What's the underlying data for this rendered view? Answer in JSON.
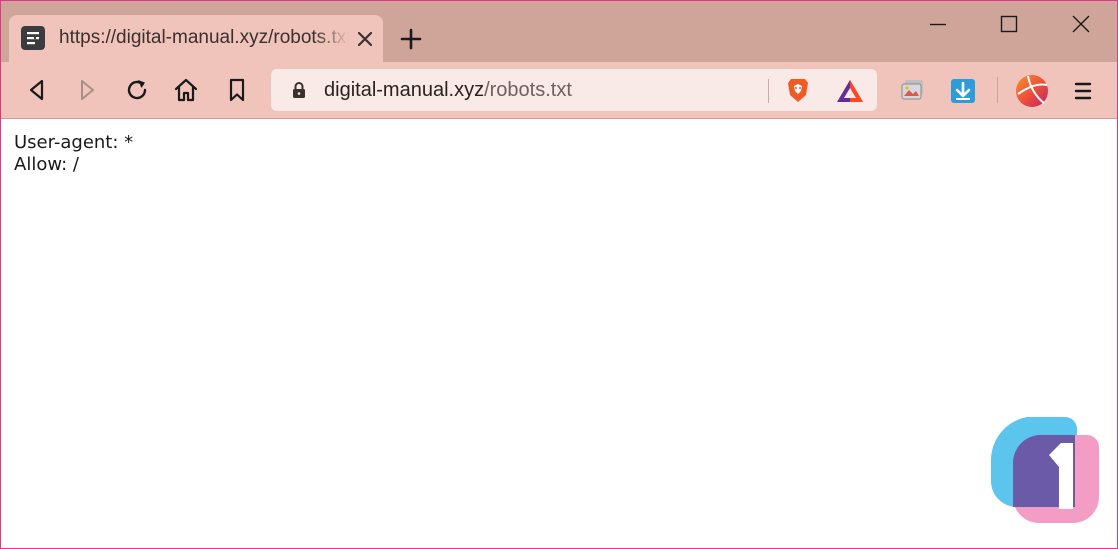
{
  "tab": {
    "title": "https://digital-manual.xyz/robots.txt",
    "favicon": "document-lines-icon"
  },
  "window_controls": {
    "minimize": "minimize-icon",
    "maximize": "maximize-icon",
    "close": "close-icon"
  },
  "navigation": {
    "back": "back-icon",
    "forward": "forward-icon",
    "reload": "reload-icon",
    "home": "home-icon",
    "bookmark": "bookmark-icon"
  },
  "address_bar": {
    "domain": "digital-manual.xyz",
    "path": "/robots.txt"
  },
  "extensions": [
    "screens-icon",
    "download-icon"
  ],
  "page": {
    "lines": [
      "User-agent: *",
      "Allow: /"
    ]
  },
  "colors": {
    "tabstrip": "#cea598",
    "toolbar": "#f0c4bb",
    "urlbar": "#f9e9e7",
    "window_border": "#e0388a",
    "brave_orange": "#f05a24",
    "download_blue": "#2d9cdb"
  }
}
